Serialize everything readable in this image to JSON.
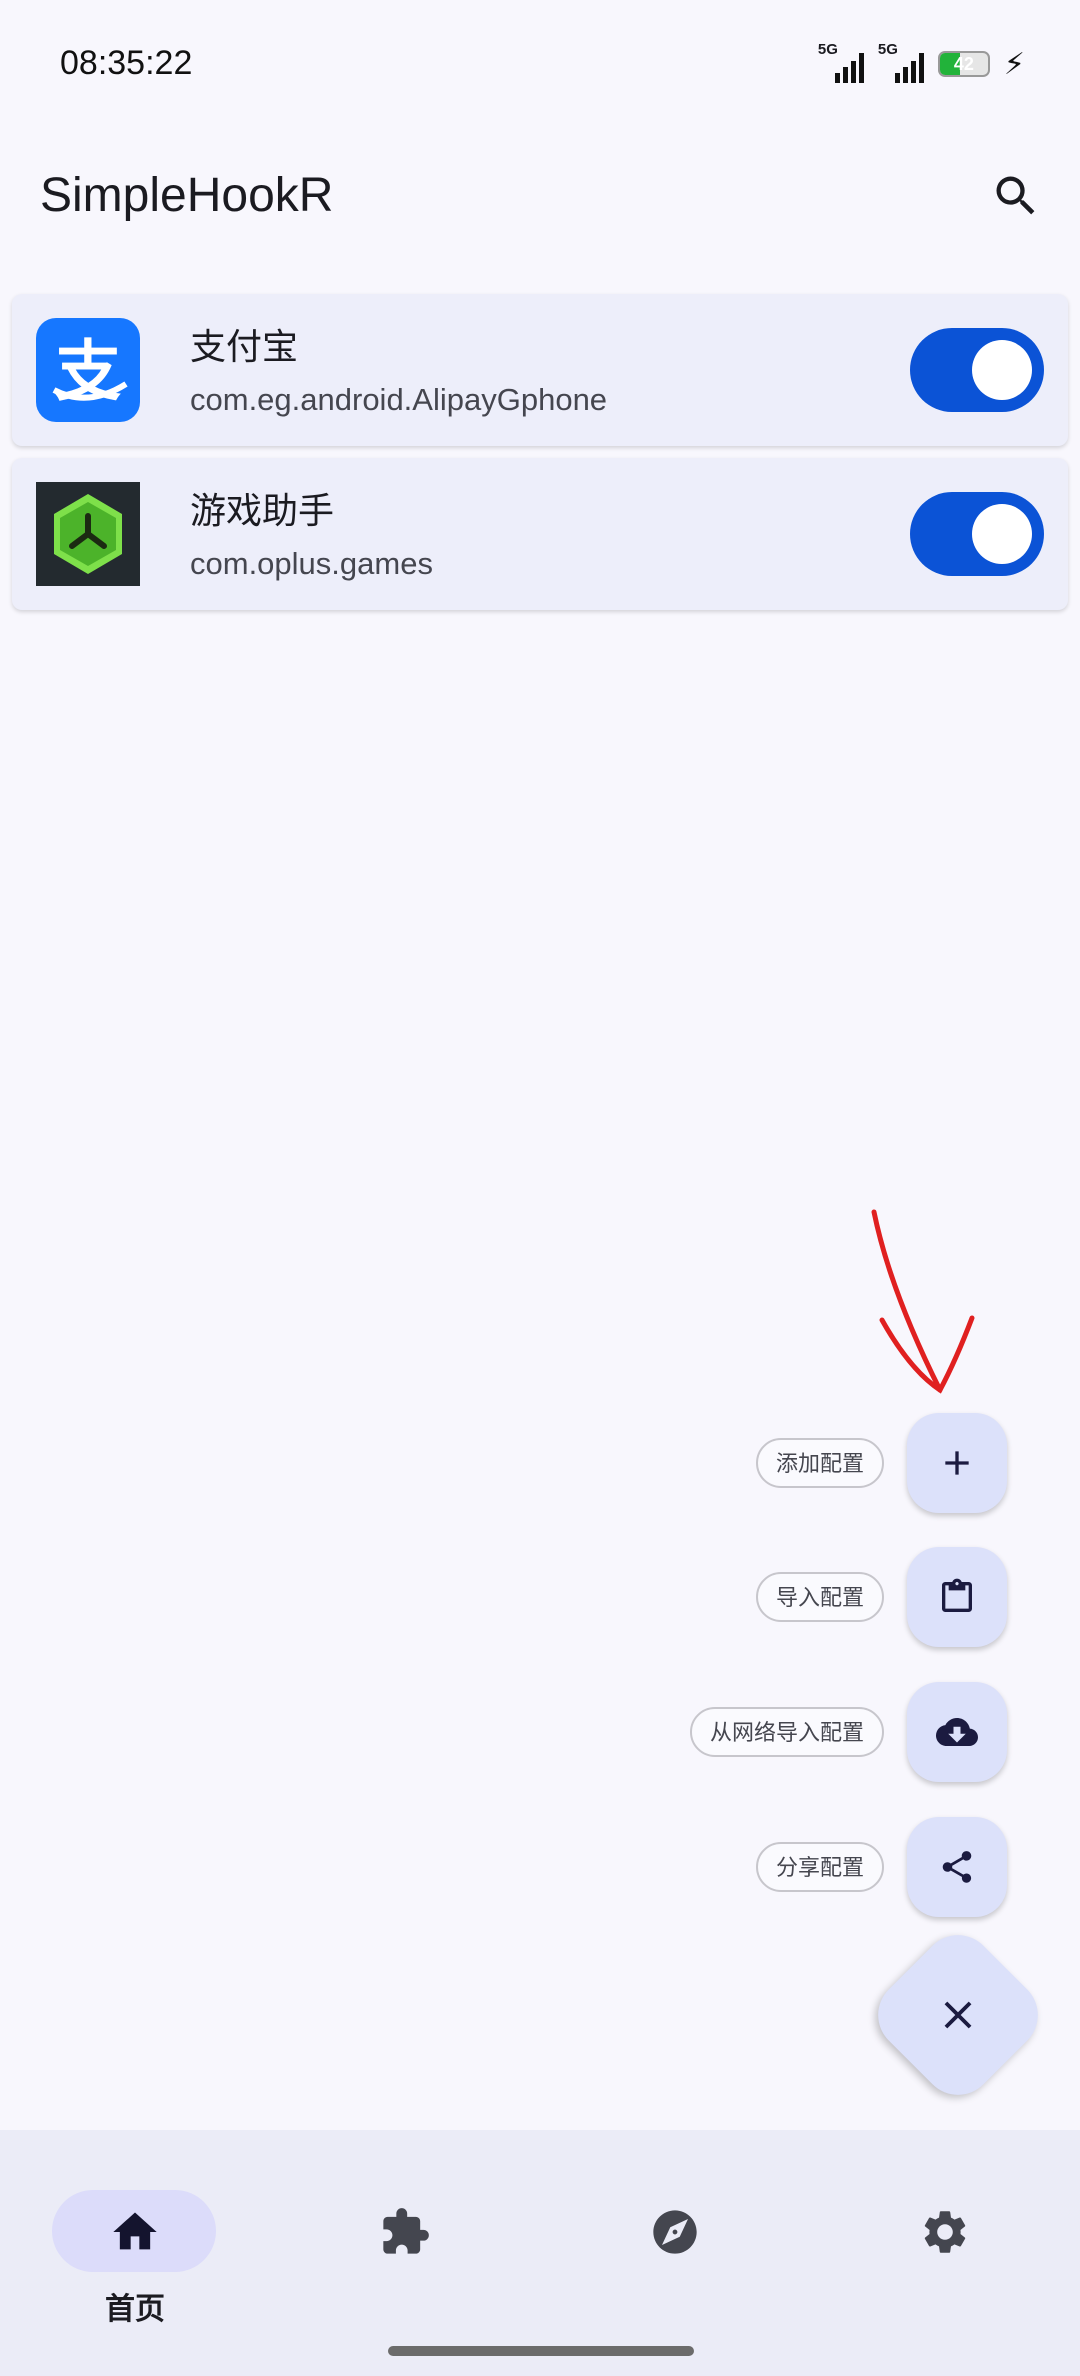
{
  "status_bar": {
    "time": "08:35:22",
    "signal1_label": "5G",
    "signal2_label": "5G",
    "battery_level": "42"
  },
  "app_bar": {
    "title": "SimpleHookR",
    "search_icon": "search-icon"
  },
  "apps": [
    {
      "name": "支付宝",
      "package": "com.eg.android.AlipayGphone",
      "icon": "alipay-icon",
      "enabled": true
    },
    {
      "name": "游戏助手",
      "package": "com.oplus.games",
      "icon": "games-icon",
      "enabled": true
    }
  ],
  "fab_menu": {
    "items": [
      {
        "label": "添加配置",
        "icon": "add-icon"
      },
      {
        "label": "导入配置",
        "icon": "clipboard-icon"
      },
      {
        "label": "从网络导入配置",
        "icon": "cloud-download-icon"
      },
      {
        "label": "分享配置",
        "icon": "share-icon"
      }
    ],
    "main_icon": "close-icon"
  },
  "bottom_nav": {
    "items": [
      {
        "label": "首页",
        "icon": "home-icon",
        "active": true
      },
      {
        "label": "",
        "icon": "puzzle-icon",
        "active": false
      },
      {
        "label": "",
        "icon": "compass-icon",
        "active": false
      },
      {
        "label": "",
        "icon": "settings-icon",
        "active": false
      }
    ]
  },
  "colors": {
    "accent": "#0b53d6",
    "fab": "#dce1fa",
    "annotation": "#e02020"
  }
}
